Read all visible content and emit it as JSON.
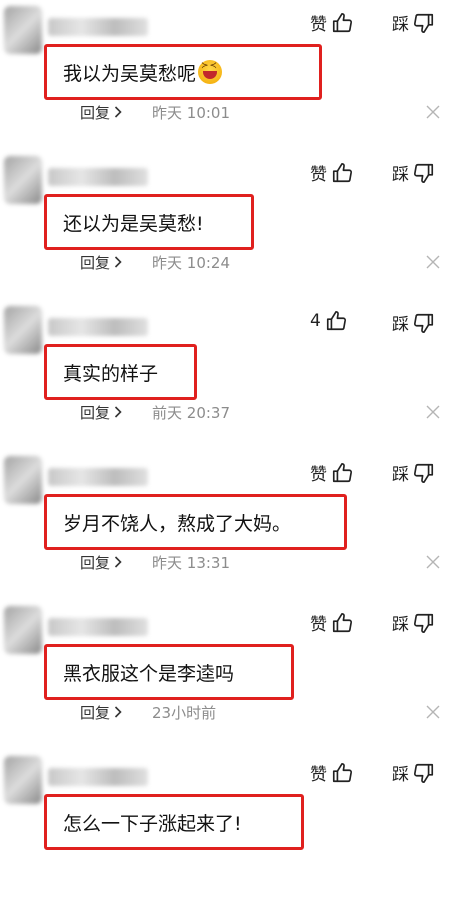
{
  "comments": [
    {
      "text": "我以为吴莫愁呢",
      "likes": "赞",
      "dislike": "踩",
      "reply": "回复",
      "time": "昨天  10:01",
      "has_emoji": true
    },
    {
      "text": "还以为是吴莫愁!",
      "likes": "赞",
      "dislike": "踩",
      "reply": "回复",
      "time": "昨天  10:24"
    },
    {
      "text": "真实的样子",
      "likes": "4",
      "dislike": "踩",
      "reply": "回复",
      "time": "前天  20:37"
    },
    {
      "text": "岁月不饶人，熬成了大妈。",
      "likes": "赞",
      "dislike": "踩",
      "reply": "回复",
      "time": "昨天  13:31"
    },
    {
      "text": "黑衣服这个是李逵吗",
      "likes": "赞",
      "dislike": "踩",
      "reply": "回复",
      "time": "23小时前"
    },
    {
      "text": "怎么一下子涨起来了!",
      "likes": "赞",
      "dislike": "踩"
    }
  ],
  "icons": {
    "like": "thumbs-up-icon",
    "dislike": "thumbs-down-icon",
    "close": "close-icon",
    "reply": "chevron-right-icon"
  },
  "colors": {
    "highlight_border": "#e0201e",
    "timestamp": "#8c8c8c"
  }
}
